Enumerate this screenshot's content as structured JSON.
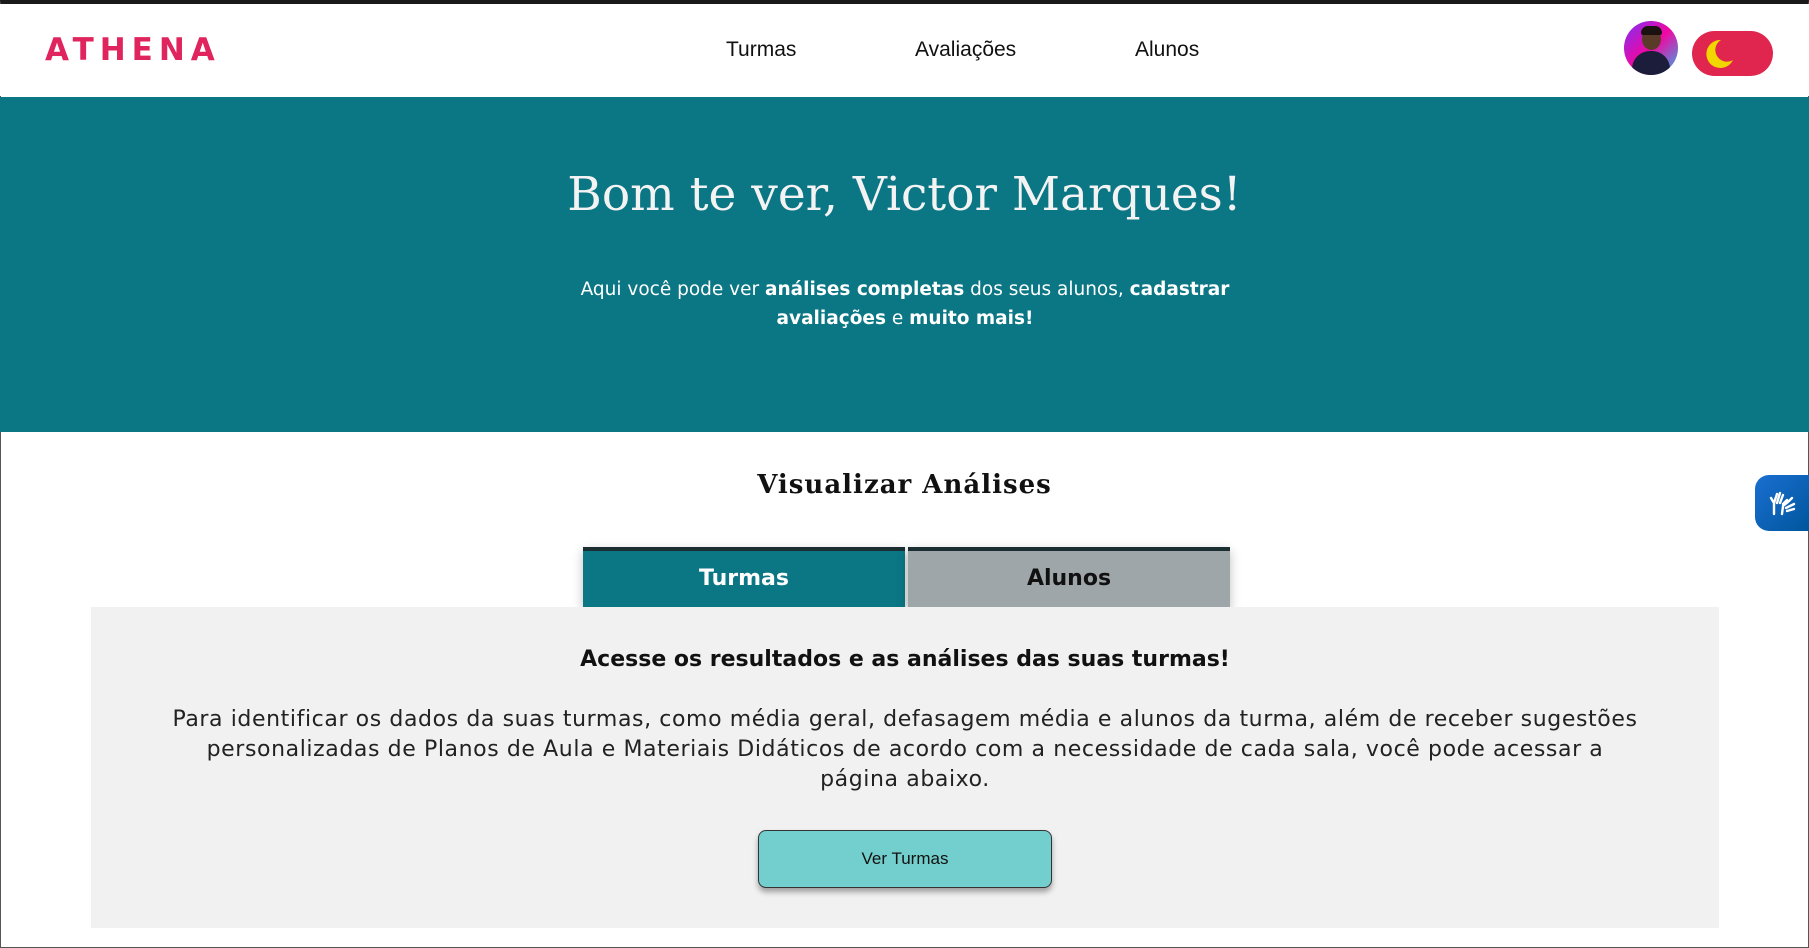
{
  "header": {
    "logo": "ATHENA",
    "nav": [
      {
        "label": "Turmas"
      },
      {
        "label": "Avaliações"
      },
      {
        "label": "Alunos"
      }
    ],
    "avatar_icon": "user-avatar",
    "theme_toggle_icon": "moon-icon"
  },
  "hero": {
    "greeting": "Bom te ver, Victor Marques!",
    "intro_1": "Aqui você pode ver ",
    "intro_bold_1": "análises completas",
    "intro_2": " dos seus alunos, ",
    "intro_bold_2": "cadastrar avaliações",
    "intro_3": " e ",
    "intro_bold_3": "muito mais!"
  },
  "analysis": {
    "title": "Visualizar Análises",
    "tabs": [
      {
        "label": "Turmas",
        "active": true
      },
      {
        "label": "Alunos",
        "active": false
      }
    ],
    "panel": {
      "heading": "Acesse os resultados e as análises das suas turmas!",
      "body": "Para identificar os dados da suas turmas, como média geral, defasagem média e alunos da turma, além de receber sugestões personalizadas de Planos de Aula e Materiais Didáticos de acordo com a necessidade de cada sala, você pode acessar a página abaixo.",
      "button_label": "Ver Turmas"
    }
  },
  "accessibility_widget_icon": "sign-language-hands-icon",
  "colors": {
    "brand": "#e0245e",
    "primary": "#0b7684",
    "toggle": "#e0254f",
    "moon": "#f2d600",
    "button": "#72cfcd",
    "tab_inactive": "#9ea6a9",
    "panel_bg": "#f1f1f1"
  }
}
